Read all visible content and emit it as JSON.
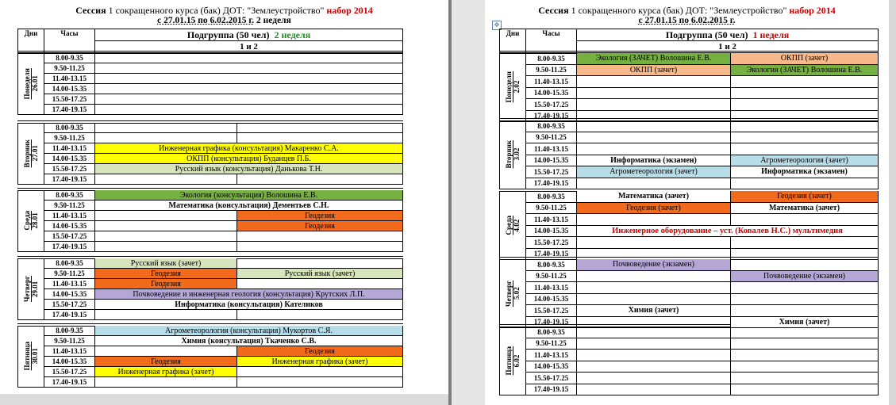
{
  "pages": [
    {
      "title_black": "Сессия",
      "title_mid": " 1 сокращенного курса (бак) ДОТ: \"Землеустройство\" ",
      "title_red": "набор 2014",
      "date_line": "с 27.01.15  по  6.02.2015 г.",
      "week_label": " 2 неделя",
      "headers": {
        "day": "Дни",
        "hours": "Часы",
        "group": "Подгруппа (50 чел)",
        "week": "2  неделя",
        "sub": "1 и 2"
      },
      "days": [
        {
          "name": "Понеделн",
          "date": "26.01"
        },
        {
          "name": "Вторник",
          "date": "27.01"
        },
        {
          "name": "Среда",
          "date": "28.01"
        },
        {
          "name": "Четверг",
          "date": "29.01"
        },
        {
          "name": "Пятница",
          "date": "30.01"
        }
      ],
      "times": [
        "8.00-9.35",
        "9.50-11.25",
        "11.40-13.15",
        "14.00-15.35",
        "15.50-17.25",
        "17.40-19.15"
      ],
      "entries": [
        {
          "text": "Инженерная графика (консультация) Макаренко С.А.",
          "color": "#ffff00"
        },
        {
          "text": "ОКПП (консультация) Буданцев П.Б.",
          "color": "#ffff00"
        },
        {
          "text": "Русский язык (консультация) Данькова Т.Н.",
          "color": "#d8e4bc"
        },
        {
          "text": "Экология (консультация) Волошина Е.В.",
          "color": "#76b041"
        },
        {
          "text": "Математика (консультация) Дементьев С.Н.",
          "color": "#ffffff"
        },
        {
          "text": "Геодезия",
          "color": "#f26b1d"
        },
        {
          "text": "Геодезия",
          "color": "#f26b1d"
        },
        {
          "text": "Русский язык (зачет)",
          "color": "#d8e4bc"
        },
        {
          "text": "Геодезия",
          "color": "#f26b1d"
        },
        {
          "text": "Русский язык (зачет)",
          "color": "#d8e4bc"
        },
        {
          "text": "Геодезия",
          "color": "#f26b1d"
        },
        {
          "text": "Почвоведение и инженерная  геология (консультация) Крутских Л.П.",
          "color": "#b4a7d6"
        },
        {
          "text": "Информатика (консультация) Кателиков",
          "color": "#ffffff"
        },
        {
          "text": "Агрометеорология (консультация) Мукортов С.Я.",
          "color": "#b7dde8"
        },
        {
          "text": "Химия (консультация) Ткаченко С.В.",
          "color": "#ffffff"
        },
        {
          "text": "Геодезия",
          "color": "#f26b1d"
        },
        {
          "text": "Геодезия",
          "color": "#f26b1d"
        },
        {
          "text": "Инженерная графика (зачет)",
          "color": "#ffff00"
        },
        {
          "text": "Инженерная графика (зачет)",
          "color": "#ffff00"
        }
      ]
    },
    {
      "title_black": "Сессия",
      "title_mid": " 1 сокращенного курса (бак) ДОТ: \"Землеустройство\" ",
      "title_red": "набор 2014",
      "date_line": "с 27.01.15  по  6.02.2015 г.",
      "headers": {
        "day": "Дни",
        "hours": "Часы",
        "group": "Подгруппа (50 чел)",
        "week": "1 неделя",
        "sub": "1 и 2"
      },
      "days": [
        {
          "name": "Понеделн",
          "date": "2.02"
        },
        {
          "name": "Вторник",
          "date": "3.02"
        },
        {
          "name": "Среда",
          "date": "4.02"
        },
        {
          "name": "Четверг",
          "date": "5.02"
        },
        {
          "name": "Пятница",
          "date": "6.02"
        }
      ],
      "times": [
        "8.00-9.35",
        "9.50-11.25",
        "11.40-13.15",
        "14.00-15.35",
        "15.50-17.25",
        "17.40-19.15"
      ],
      "entries": [
        {
          "text": "Экология (ЗАЧЕТ) Волошина Е.В.",
          "color": "#76b041"
        },
        {
          "text": "ОКПП (зачет)",
          "color": "#f8b98a"
        },
        {
          "text": "ОКПП (зачет)",
          "color": "#f8b98a"
        },
        {
          "text": "Экология (ЗАЧЕТ) Волошина Е.В.",
          "color": "#76b041"
        },
        {
          "text": "Информатика (экзамен)",
          "color": "#ffffff"
        },
        {
          "text": "Агрометеорология (зачет)",
          "color": "#b7dde8"
        },
        {
          "text": "Агрометеорология (зачет)",
          "color": "#b7dde8"
        },
        {
          "text": "Информатика (экзамен)",
          "color": "#ffffff"
        },
        {
          "text": "Математика (зачет)",
          "color": "#ffffff"
        },
        {
          "text": "Геодезия (зачет)",
          "color": "#f26b1d"
        },
        {
          "text": "Геодезия (зачет)",
          "color": "#f26b1d"
        },
        {
          "text": "Математика (зачет)",
          "color": "#ffffff"
        },
        {
          "text": "Инженерное оборудование – уст. (Ковалев Н.С.) мультимедия",
          "color": "#ffffff"
        },
        {
          "text": "Почвоведение (экзамен)",
          "color": "#b4a7d6"
        },
        {
          "text": "Почвоведение (экзамен)",
          "color": "#b4a7d6"
        },
        {
          "text": "Химия (зачет)",
          "color": "#ffffff"
        },
        {
          "text": "Химия (зачет)",
          "color": "#ffffff"
        }
      ]
    }
  ]
}
